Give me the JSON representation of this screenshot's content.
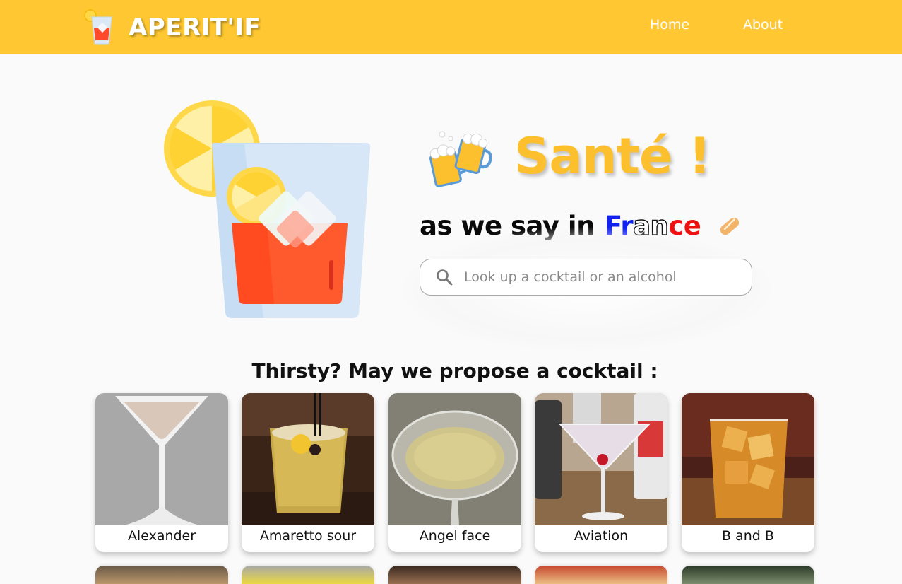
{
  "navbar": {
    "brand": "APERIT'IF",
    "links": [
      {
        "label": "Home"
      },
      {
        "label": "About"
      }
    ]
  },
  "hero": {
    "title": "Santé !",
    "subtitle_prefix": "as we say in",
    "subtitle_country": {
      "part1": "Fr",
      "part2": "an",
      "part3": "ce"
    },
    "search": {
      "placeholder": "Look up a cocktail or an alcohol",
      "value": ""
    }
  },
  "proposals": {
    "title": "Thirsty? May we propose a cocktail :",
    "cocktails": [
      {
        "name": "Alexander",
        "icon": "martini-glass-image"
      },
      {
        "name": "Amaretto sour",
        "icon": "rocks-glass-image"
      },
      {
        "name": "Angel face",
        "icon": "coupe-glass-image"
      },
      {
        "name": "Aviation",
        "icon": "martini-cherry-image"
      },
      {
        "name": "B and B",
        "icon": "whiskey-ice-image"
      }
    ]
  },
  "colors": {
    "accent": "#ffc832",
    "title": "#fcc02e",
    "france_blue": "#1022ee",
    "france_red": "#ee1111"
  }
}
